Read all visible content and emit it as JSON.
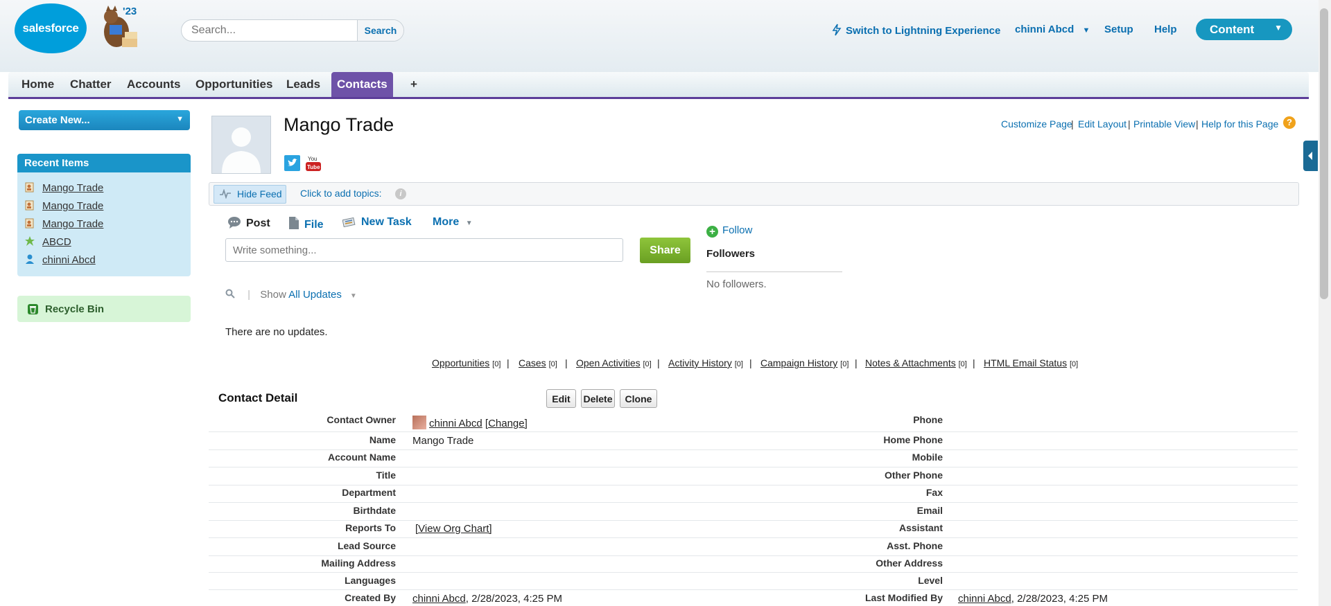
{
  "header": {
    "logo_text": "salesforce",
    "release_label": "'23",
    "search": {
      "placeholder": "Search...",
      "button": "Search"
    },
    "switch_lightning": "Switch to Lightning Experience",
    "user_menu": "chinni Abcd",
    "setup": "Setup",
    "help": "Help",
    "app_menu": "Content"
  },
  "tabs": [
    {
      "label": "Home"
    },
    {
      "label": "Chatter"
    },
    {
      "label": "Accounts"
    },
    {
      "label": "Opportunities"
    },
    {
      "label": "Leads"
    },
    {
      "label": "Contacts",
      "active": true
    },
    {
      "label": "+"
    }
  ],
  "sidebar": {
    "create_new": "Create New...",
    "recent_items_title": "Recent Items",
    "recent_items": [
      {
        "label": "Mango Trade",
        "icon": "contact-icon"
      },
      {
        "label": "Mango Trade",
        "icon": "contact-icon"
      },
      {
        "label": "Mango Trade",
        "icon": "contact-icon"
      },
      {
        "label": "ABCD",
        "icon": "account-icon"
      },
      {
        "label": "chinni Abcd",
        "icon": "user-icon"
      }
    ],
    "recycle_bin": "Recycle Bin"
  },
  "record": {
    "title": "Mango Trade",
    "page_links": [
      "Customize Page",
      "Edit Layout",
      "Printable View",
      "Help for this Page"
    ]
  },
  "feed": {
    "hide_feed": "Hide Feed",
    "add_topics": "Click to add topics:",
    "publisher_tabs": [
      "Post",
      "File",
      "New Task",
      "More"
    ],
    "write_placeholder": "Write something...",
    "share": "Share",
    "show_label": "Show",
    "filter": "All Updates",
    "no_updates": "There are no updates.",
    "follow": "Follow",
    "followers_title": "Followers",
    "no_followers": "No followers."
  },
  "related_lists": [
    {
      "label": "Opportunities",
      "count": "[0]"
    },
    {
      "label": "Cases",
      "count": "[0]"
    },
    {
      "label": "Open Activities",
      "count": "[0]"
    },
    {
      "label": "Activity History",
      "count": "[0]"
    },
    {
      "label": "Campaign History",
      "count": "[0]"
    },
    {
      "label": "Notes & Attachments",
      "count": "[0]"
    },
    {
      "label": "HTML Email Status",
      "count": "[0]"
    }
  ],
  "detail": {
    "title": "Contact Detail",
    "buttons": [
      "Edit",
      "Delete",
      "Clone"
    ],
    "owner_name": "chinni Abcd",
    "owner_change": "[Change]",
    "name_value": "Mango Trade",
    "org_chart": "[View Org Chart]",
    "created_by_name": "chinni Abcd",
    "created_by_date": ", 2/28/2023, 4:25 PM",
    "modified_by_name": "chinni Abcd",
    "modified_by_date": ", 2/28/2023, 4:25 PM",
    "left_labels": [
      "Contact Owner",
      "Name",
      "Account Name",
      "Title",
      "Department",
      "Birthdate",
      "Reports To",
      "Lead Source",
      "Mailing Address",
      "Languages",
      "Created By"
    ],
    "right_labels": [
      "Phone",
      "Home Phone",
      "Mobile",
      "Other Phone",
      "Fax",
      "Email",
      "Assistant",
      "Asst. Phone",
      "Other Address",
      "Level",
      "Last Modified By"
    ]
  }
}
